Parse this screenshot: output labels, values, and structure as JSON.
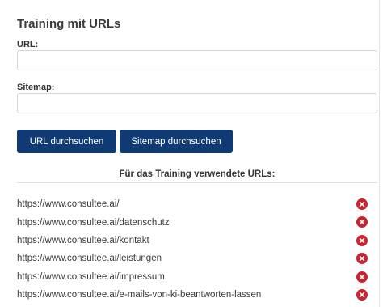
{
  "title": "Training mit URLs",
  "url_field": {
    "label": "URL:",
    "value": "",
    "placeholder": ""
  },
  "sitemap_field": {
    "label": "Sitemap:",
    "value": "",
    "placeholder": ""
  },
  "buttons": {
    "search_url": "URL durchsuchen",
    "search_sitemap": "Sitemap durchsuchen"
  },
  "colors": {
    "button_bg": "#0f3a73",
    "remove_icon": "#d0212e"
  },
  "used_urls": {
    "heading": "Für das Training verwendete URLs:",
    "items": [
      "https://www.consultee.ai/",
      "https://www.consultee.ai/datenschutz",
      "https://www.consultee.ai/kontakt",
      "https://www.consultee.ai/leistungen",
      "https://www.consultee.ai/impressum",
      "https://www.consultee.ai/e-mails-von-ki-beantworten-lassen"
    ],
    "remove_icon_name": "remove-circle-x-icon"
  }
}
